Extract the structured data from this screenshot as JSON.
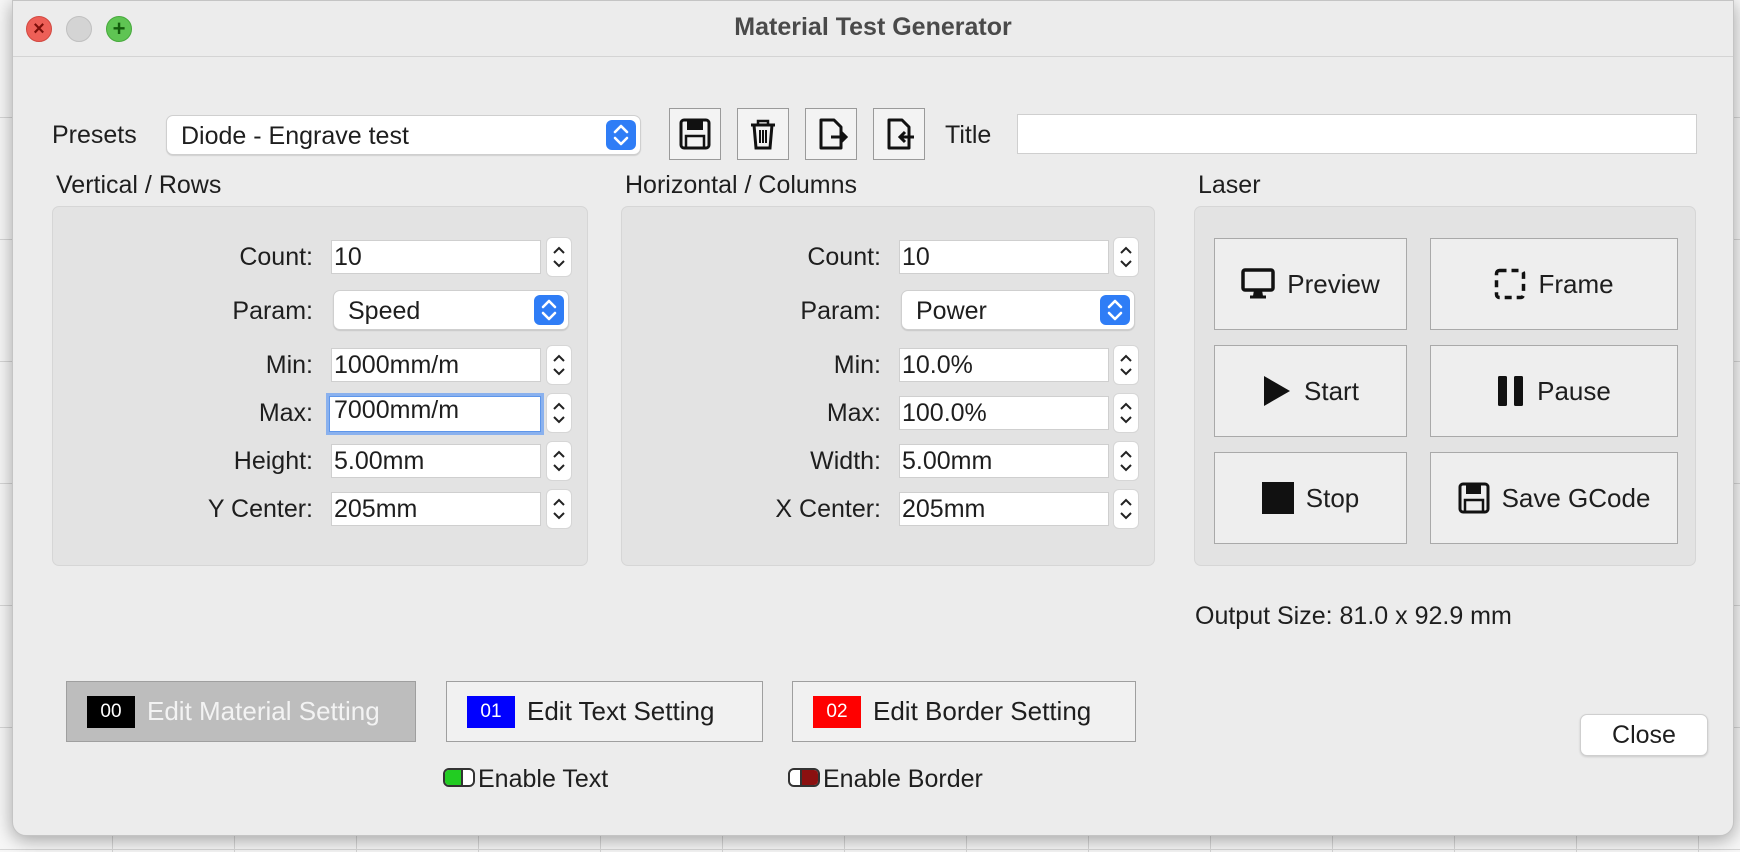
{
  "window": {
    "title": "Material Test Generator"
  },
  "presets": {
    "label": "Presets",
    "selected": "Diode - Engrave test",
    "title_label": "Title",
    "title_value": ""
  },
  "rows": {
    "heading": "Vertical / Rows",
    "count_label": "Count:",
    "count": "10",
    "param_label": "Param:",
    "param": "Speed",
    "min_label": "Min:",
    "min": "1000mm/m",
    "max_label": "Max:",
    "max": "7000mm/m",
    "height_label": "Height:",
    "height": "5.00mm",
    "ycenter_label": "Y Center:",
    "ycenter": "205mm"
  },
  "cols": {
    "heading": "Horizontal / Columns",
    "count_label": "Count:",
    "count": "10",
    "param_label": "Param:",
    "param": "Power",
    "min_label": "Min:",
    "min": "10.0%",
    "max_label": "Max:",
    "max": "100.0%",
    "width_label": "Width:",
    "width": "5.00mm",
    "xcenter_label": "X Center:",
    "xcenter": "205mm"
  },
  "laser": {
    "heading": "Laser",
    "preview": "Preview",
    "frame": "Frame",
    "start": "Start",
    "pause": "Pause",
    "stop": "Stop",
    "save_gcode": "Save GCode"
  },
  "output_size": "Output Size: 81.0 x 92.9 mm",
  "edit": {
    "material": {
      "label": "Edit Material Setting",
      "layer": "00",
      "color": "#000000"
    },
    "text": {
      "label": "Edit Text Setting",
      "layer": "01",
      "color": "#0000ff"
    },
    "border": {
      "label": "Edit Border Setting",
      "layer": "02",
      "color": "#ff0000"
    }
  },
  "enable_text": {
    "label": "Enable Text",
    "on": true,
    "color": "#22cc22"
  },
  "enable_border": {
    "label": "Enable Border",
    "on": false,
    "color": "#8b1010"
  },
  "close": "Close"
}
